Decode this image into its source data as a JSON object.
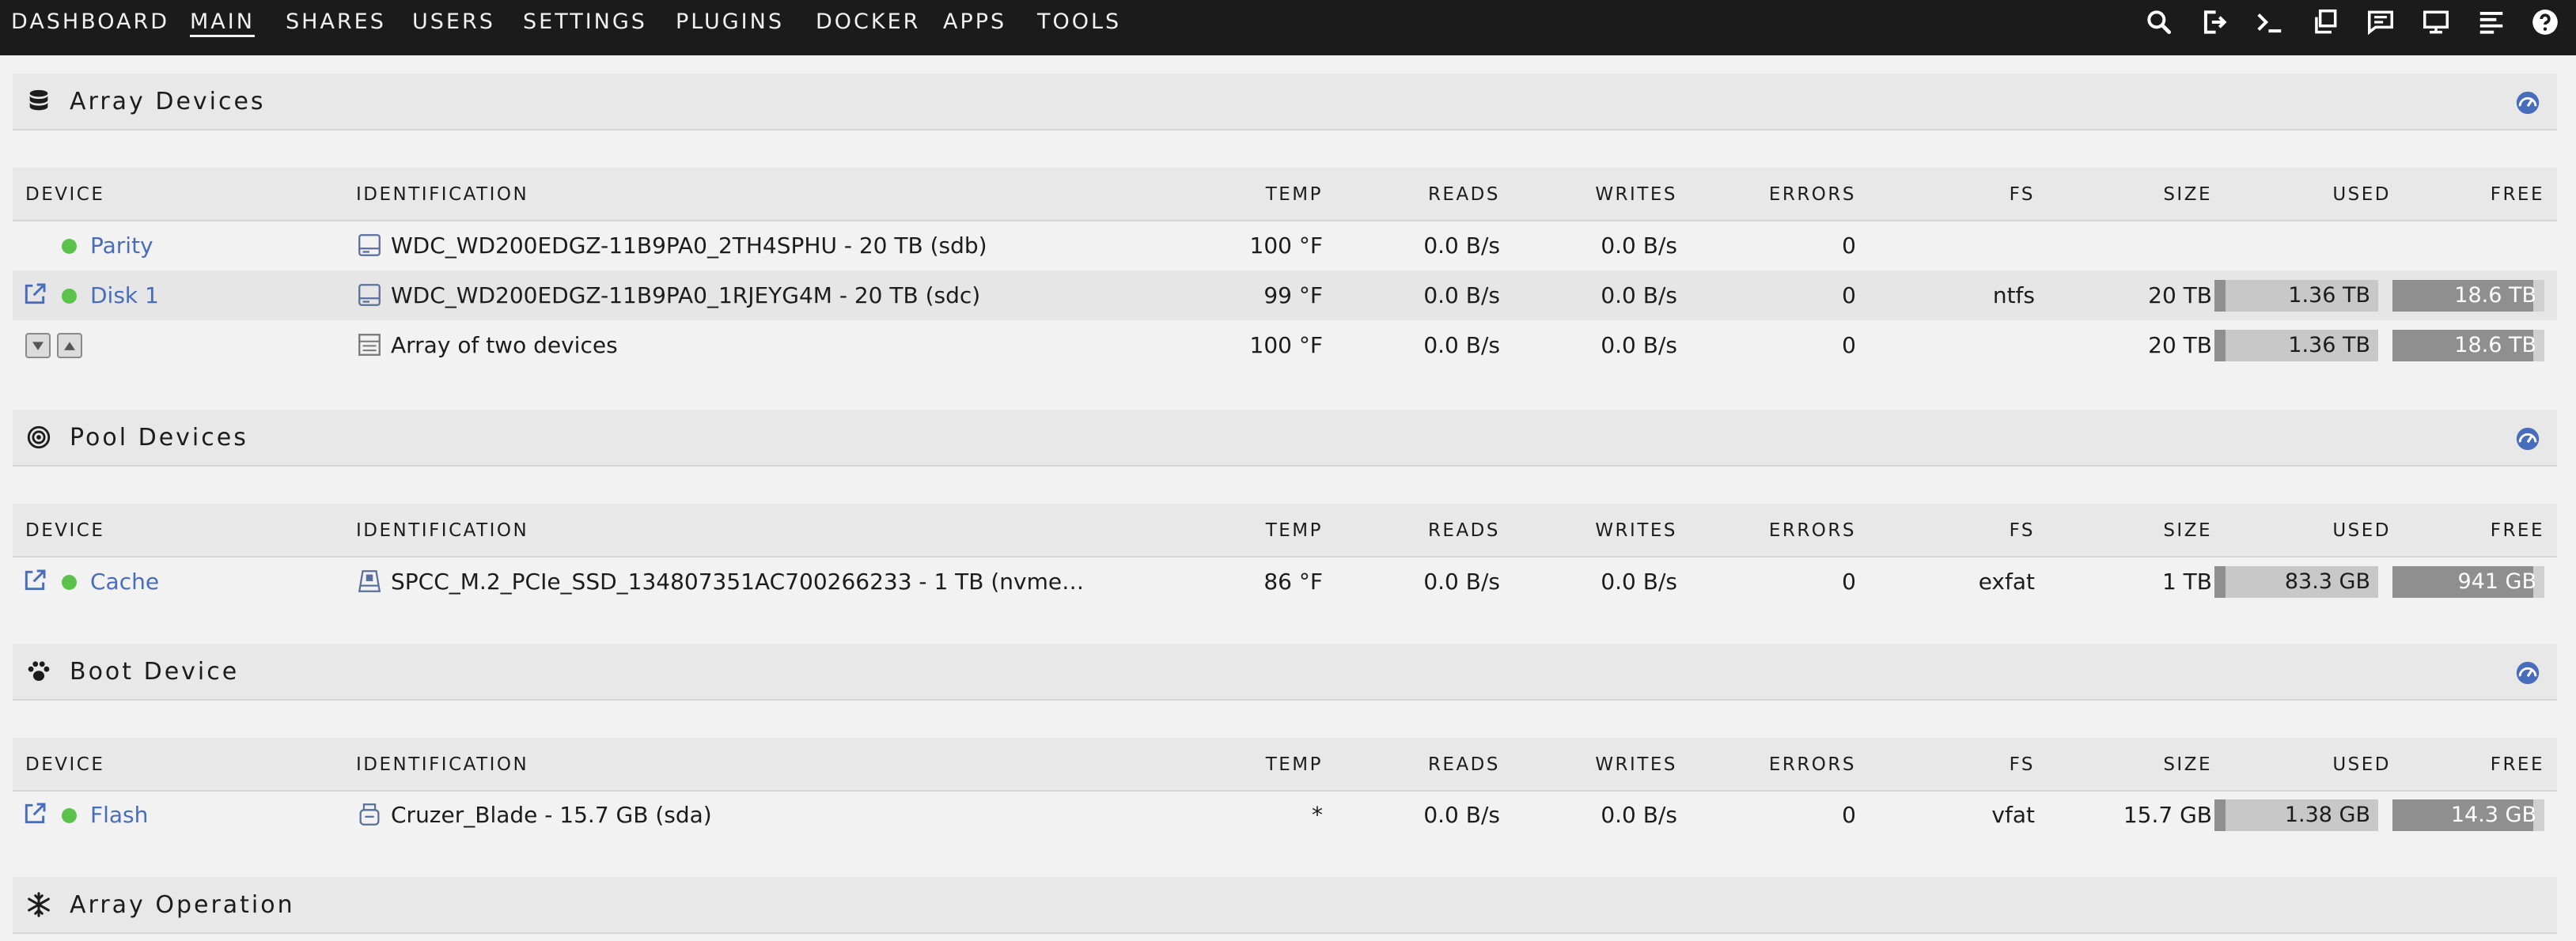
{
  "nav": {
    "items": [
      "DASHBOARD",
      "MAIN",
      "SHARES",
      "USERS",
      "SETTINGS",
      "PLUGINS",
      "DOCKER",
      "APPS",
      "TOOLS"
    ],
    "active": "MAIN",
    "icons": [
      "search-icon",
      "logout-icon",
      "terminal-icon",
      "windows-icon",
      "feedback-icon",
      "monitor-icon",
      "log-icon",
      "help-icon"
    ]
  },
  "columns": [
    "DEVICE",
    "IDENTIFICATION",
    "TEMP",
    "READS",
    "WRITES",
    "ERRORS",
    "FS",
    "SIZE",
    "USED",
    "FREE"
  ],
  "array": {
    "title": "Array Devices",
    "rows": [
      {
        "device": "Parity",
        "status": "green",
        "ident": "WDC_WD200EDGZ-11B9PA0_2TH4SPHU - 20 TB (sdb)",
        "temp": "100 °F",
        "reads": "0.0 B/s",
        "writes": "0.0 B/s",
        "errors": "0",
        "fs": "",
        "size": "",
        "used": "",
        "free": ""
      },
      {
        "device": "Disk 1",
        "status": "green",
        "ident": "WDC_WD200EDGZ-11B9PA0_1RJEYG4M - 20 TB (sdc)",
        "temp": "99 °F",
        "reads": "0.0 B/s",
        "writes": "0.0 B/s",
        "errors": "0",
        "fs": "ntfs",
        "size": "20 TB",
        "used": "1.36 TB",
        "free": "18.6 TB"
      },
      {
        "device": "",
        "status": "",
        "ident": "Array of two devices",
        "temp": "100 °F",
        "reads": "0.0 B/s",
        "writes": "0.0 B/s",
        "errors": "0",
        "fs": "",
        "size": "20 TB",
        "used": "1.36 TB",
        "free": "18.6 TB"
      }
    ]
  },
  "pool": {
    "title": "Pool Devices",
    "rows": [
      {
        "device": "Cache",
        "status": "green",
        "ident": "SPCC_M.2_PCIe_SSD_134807351AC700266233 - 1 TB (nvme…",
        "temp": "86 °F",
        "reads": "0.0 B/s",
        "writes": "0.0 B/s",
        "errors": "0",
        "fs": "exfat",
        "size": "1 TB",
        "used": "83.3 GB",
        "free": "941 GB"
      }
    ]
  },
  "boot": {
    "title": "Boot Device",
    "rows": [
      {
        "device": "Flash",
        "status": "green",
        "ident": "Cruzer_Blade - 15.7 GB (sda)",
        "temp": "*",
        "reads": "0.0 B/s",
        "writes": "0.0 B/s",
        "errors": "0",
        "fs": "vfat",
        "size": "15.7 GB",
        "used": "1.38 GB",
        "free": "14.3 GB"
      }
    ]
  },
  "operation": {
    "title": "Array Operation"
  },
  "colors": {
    "topbar": "#1c1b1b",
    "link": "#486dba",
    "status_green": "#5bc24b",
    "used_bar": "#c8c8c8",
    "free_bar": "#8f8f8f"
  }
}
